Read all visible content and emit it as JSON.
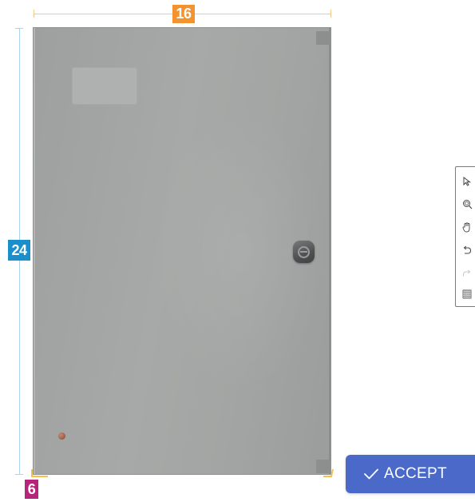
{
  "dimensions": {
    "width_label": "16",
    "height_label": "24",
    "depth_label": "6",
    "colors": {
      "width": "#f3922e",
      "height": "#1a8fcb",
      "depth": "#b5257a"
    }
  },
  "product": {
    "type": "enclosure-cabinet",
    "color": "#a5a7a6",
    "lock_icon": "e-logo-lock-icon"
  },
  "toolbar": {
    "tools": [
      {
        "name": "select",
        "icon": "cursor-arrow-icon"
      },
      {
        "name": "zoom",
        "icon": "zoom-magnifier-icon"
      },
      {
        "name": "pan",
        "icon": "hand-pan-icon"
      },
      {
        "name": "undo",
        "icon": "undo-arrow-icon"
      },
      {
        "name": "redo",
        "icon": "redo-arrow-icon",
        "disabled": true
      },
      {
        "name": "grid",
        "icon": "grid-icon"
      }
    ]
  },
  "accept_button": {
    "label": "ACCEPT",
    "icon": "checkmark-icon",
    "color": "#4b69c8"
  }
}
